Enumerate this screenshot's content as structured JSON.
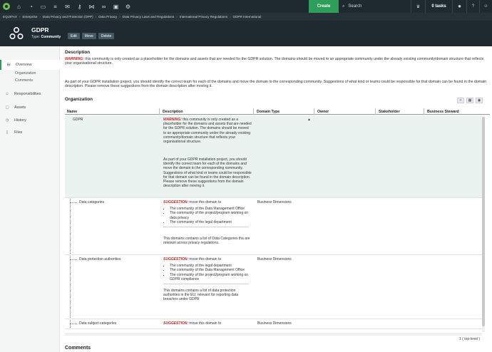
{
  "topbar": {
    "nav_icons": [
      "dashboard-icon",
      "gauge-icon",
      "folder-icon",
      "database-icon",
      "mail-icon",
      "key-icon",
      "share-icon",
      "link-icon",
      "clipboard-icon",
      "gear-icon"
    ],
    "create_label": "Create",
    "search_placeholder": "Search",
    "tasks_label": "0 tasks",
    "colors": {
      "bar": "#1f2a30",
      "create": "#2e9e5b"
    }
  },
  "breadcrumb": [
    "EQUIFAX",
    "Enterprise",
    "Data Privacy and Protection (DPP)",
    "Data Privacy",
    "Data Privacy Laws and Regulations",
    "International Privacy Regulations",
    "GDPR International"
  ],
  "asset": {
    "title": "GDPR",
    "type_label": "Type:",
    "type_value": "Community",
    "buttons": [
      "Edit",
      "Move",
      "Delete"
    ]
  },
  "sidebar": {
    "overview": "Overview",
    "sub_items": [
      "Organization",
      "Comments"
    ],
    "items": [
      "Responsibilities",
      "Assets",
      "History",
      "Files"
    ]
  },
  "description": {
    "title": "Description",
    "warning_label": "WARNING:",
    "paragraph1": " this community is only created as a placeholder for the domains and assets that are needed for the GDPR solution. The domains should be moved to an appropriate community under the already existing community/domain structure that reflects your organisational structure.",
    "paragraph2": "As part of your GDPR installation project, you should identify the correct team for each of the domains and move the domain to the corresponding community. Suggestions of what kind or teams could be responsible for that domain can be found in the domain description. Please remove these suggestions from the domain description after moving it."
  },
  "organization": {
    "title": "Organization",
    "columns": [
      "Name",
      "Description",
      "Domain Type",
      "Owner",
      "Stakeholder",
      "Business Steward"
    ],
    "rows": [
      {
        "name": "GDPR",
        "warning_label": "WARNING:",
        "desc1": " this community is only created as a placeholder for the domains and assets that are needed for the GDPR solution. The domains should be moved to an appropriate community under the already existing community/domain structure that reflects your organisational structure.",
        "desc2": "As part of your GDPR installation project, you should identify the correct team for each of the domains and move the domain to the corresponding community. Suggestions of what kind or teams could be responsible for that domain can be found in the domain description. Please remove these suggestions from the domain description after moving it.",
        "domain_type": ""
      },
      {
        "name": "Data categories",
        "suggestion_label": "SUGGESTION:",
        "suggestion_text": " move this domain to",
        "bullets": [
          "The community of the Data Management Office",
          "The community of the project/program working on data privacy",
          "The community of the legal department"
        ],
        "note": "This domains contains a list of Data Categories tha are relevant across privacy regulations.",
        "domain_type": "Business Dimensions"
      },
      {
        "name": "Data protection authorities",
        "suggestion_label": "SUGGESTION:",
        "suggestion_text": " move this domain to",
        "bullets": [
          "The community of the legal department",
          "The community of the Data Management Office",
          "The community of the project/program working on GDPR compliance"
        ],
        "note": "This domains contains a list of data protection authorities in the EU, relevant for reporting data breaches under GDPR",
        "domain_type": "Business Dimensions"
      },
      {
        "name": "Data subject categories",
        "suggestion_label": "SUGGESTION:",
        "suggestion_text": " move this domain to",
        "domain_type": "Business Dimensions"
      }
    ],
    "pager": "1 ( top-level )"
  },
  "comments": {
    "title": "Comments"
  }
}
